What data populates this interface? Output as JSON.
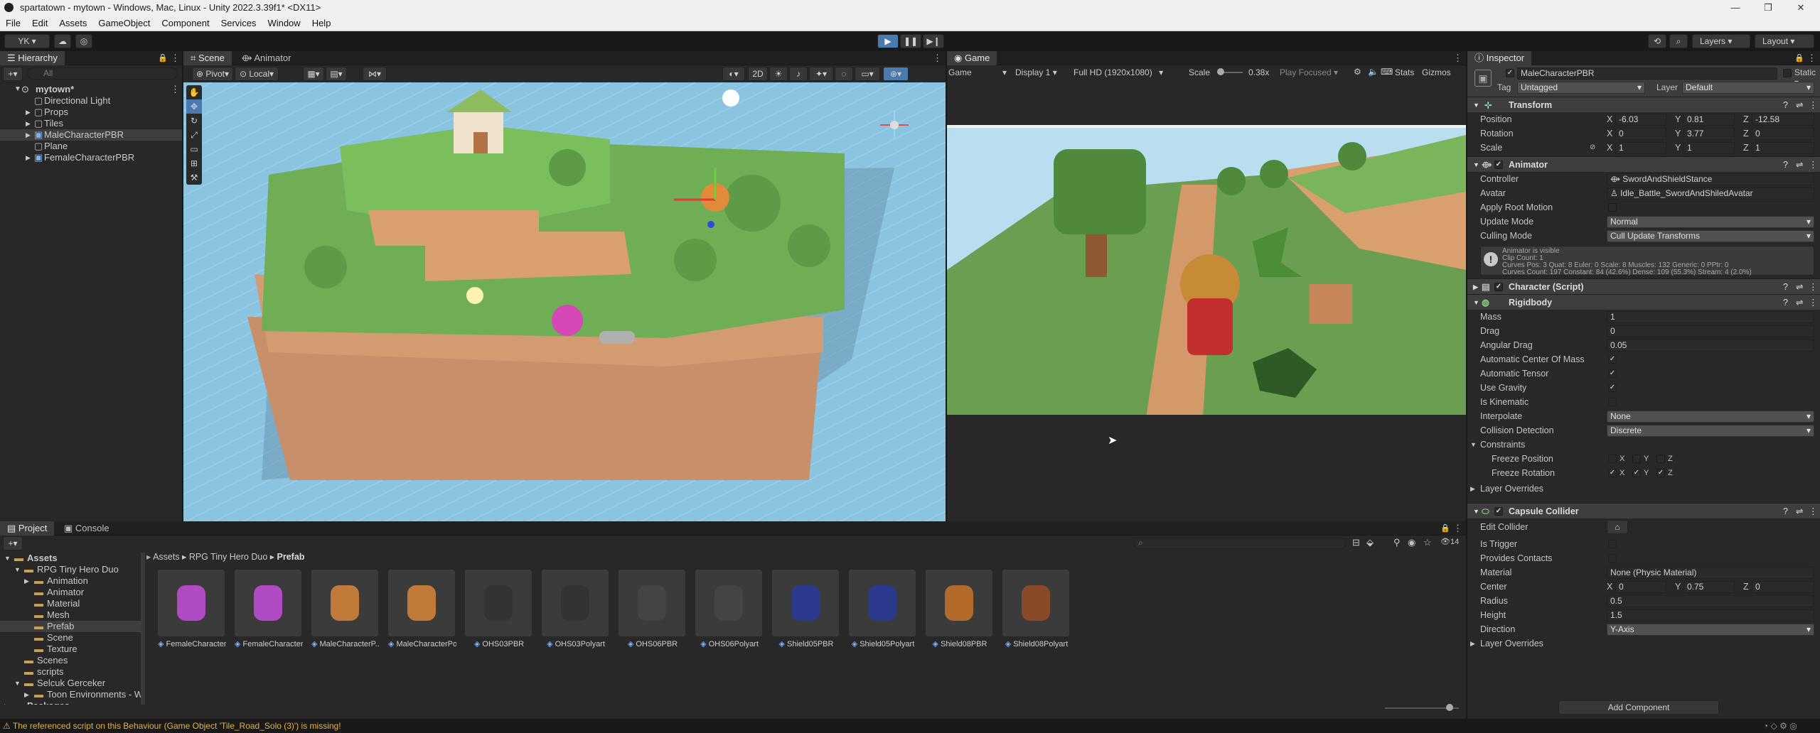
{
  "window": {
    "title": "spartatown - mytown - Windows, Mac, Linux - Unity 2022.3.39f1* <DX11>",
    "minimize": "—",
    "maximize": "❐",
    "close": "✕"
  },
  "menu": [
    "File",
    "Edit",
    "Assets",
    "GameObject",
    "Component",
    "Services",
    "Window",
    "Help"
  ],
  "toolbar": {
    "account": "YK ▾",
    "play": "▶",
    "pause": "❚❚",
    "step": "▶❙",
    "layers": "Layers",
    "layout": "Layout"
  },
  "hierarchy": {
    "tab": "Hierarchy",
    "search_placeholder": "All",
    "scene": "mytown*",
    "items": [
      "Directional Light",
      "Props",
      "Tiles",
      "MaleCharacterPBR",
      "Plane",
      "FemaleCharacterPBR"
    ],
    "selected": 3
  },
  "scene": {
    "tab": "Scene",
    "tab2": "Animator",
    "pivot": "Pivot",
    "local": "Local",
    "mode2d": "2D"
  },
  "game": {
    "tab": "Game",
    "view": "Game",
    "display": "Display 1",
    "res": "Full HD (1920x1080)",
    "scale_label": "Scale",
    "scale": "0.38x",
    "play_focused": "Play Focused",
    "stats": "Stats",
    "gizmos": "Gizmos"
  },
  "inspector": {
    "tab": "Inspector",
    "name": "MaleCharacterPBR",
    "static": "Static",
    "tag_label": "Tag",
    "tag": "Untagged",
    "layer_label": "Layer",
    "layer": "Default",
    "transform": {
      "title": "Transform",
      "pos": "Position",
      "rot": "Rotation",
      "scale": "Scale",
      "px": "-6.03",
      "py": "0.81",
      "pz": "-12.58",
      "rx": "0",
      "ry": "3.77",
      "rz": "0",
      "sx": "1",
      "sy": "1",
      "sz": "1",
      "x": "X",
      "y": "Y",
      "z": "Z"
    },
    "animator": {
      "title": "Animator",
      "controller_label": "Controller",
      "controller": "SwordAndShieldStance",
      "avatar_label": "Avatar",
      "avatar": "Idle_Battle_SwordAndShiledAvatar",
      "root_motion": "Apply Root Motion",
      "update_label": "Update Mode",
      "update": "Normal",
      "culling_label": "Culling Mode",
      "culling": "Cull Update Transforms",
      "info1": "Animator is visible",
      "info2": "Clip Count: 1",
      "info3": "Curves Pos: 3 Quat: 8 Euler: 0 Scale: 8 Muscles: 132 Generic: 0 PPtr: 0",
      "info4": "Curves Count: 197 Constant: 84 (42.6%) Dense: 109 (55.3%) Stream: 4 (2.0%)"
    },
    "character": {
      "title": "Character (Script)"
    },
    "rigidbody": {
      "title": "Rigidbody",
      "mass_l": "Mass",
      "mass": "1",
      "drag_l": "Drag",
      "drag": "0",
      "adrag_l": "Angular Drag",
      "adrag": "0.05",
      "acom": "Automatic Center Of Mass",
      "atensor": "Automatic Tensor",
      "grav": "Use Gravity",
      "kin": "Is Kinematic",
      "interp_l": "Interpolate",
      "interp": "None",
      "coll_l": "Collision Detection",
      "coll": "Discrete",
      "constraints": "Constraints",
      "fpos": "Freeze Position",
      "frot": "Freeze Rotation",
      "layer_ov": "Layer Overrides"
    },
    "capsule": {
      "title": "Capsule Collider",
      "edit": "Edit Collider",
      "trigger": "Is Trigger",
      "contacts": "Provides Contacts",
      "mat_l": "Material",
      "mat": "None (Physic Material)",
      "center_l": "Center",
      "cx": "0",
      "cy": "0.75",
      "cz": "0",
      "radius_l": "Radius",
      "radius": "0.5",
      "height_l": "Height",
      "height": "1.5",
      "dir_l": "Direction",
      "dir": "Y-Axis",
      "layer_ov": "Layer Overrides"
    },
    "add_component": "Add Component"
  },
  "project": {
    "tab": "Project",
    "tab2": "Console",
    "count": "14",
    "breadcrumb": [
      "Assets",
      "RPG Tiny Hero Duo",
      "Prefab"
    ],
    "tree": [
      {
        "t": "Assets",
        "d": 0,
        "o": "▼"
      },
      {
        "t": "RPG Tiny Hero Duo",
        "d": 1,
        "o": "▼"
      },
      {
        "t": "Animation",
        "d": 2,
        "o": "▶"
      },
      {
        "t": "Animator",
        "d": 2,
        "o": ""
      },
      {
        "t": "Material",
        "d": 2,
        "o": ""
      },
      {
        "t": "Mesh",
        "d": 2,
        "o": ""
      },
      {
        "t": "Prefab",
        "d": 2,
        "o": ""
      },
      {
        "t": "Scene",
        "d": 2,
        "o": ""
      },
      {
        "t": "Texture",
        "d": 2,
        "o": ""
      },
      {
        "t": "Scenes",
        "d": 1,
        "o": ""
      },
      {
        "t": "scripts",
        "d": 1,
        "o": ""
      },
      {
        "t": "Selcuk Gerceker",
        "d": 1,
        "o": "▼"
      },
      {
        "t": "Toon Environments - W",
        "d": 2,
        "o": "▶"
      },
      {
        "t": "Packages",
        "d": 0,
        "o": "▶"
      }
    ],
    "assets": [
      "FemaleCharacter...",
      "FemaleCharacter...",
      "MaleCharacterP...",
      "MaleCharacterPo...",
      "OHS03PBR",
      "OHS03Polyart",
      "OHS06PBR",
      "OHS06Polyart",
      "Shield05PBR",
      "Shield05Polyart",
      "Shield08PBR",
      "Shield08Polyart"
    ]
  },
  "status": "The referenced script on this Behaviour (Game Object 'Tile_Road_Solo (3)') is missing!"
}
